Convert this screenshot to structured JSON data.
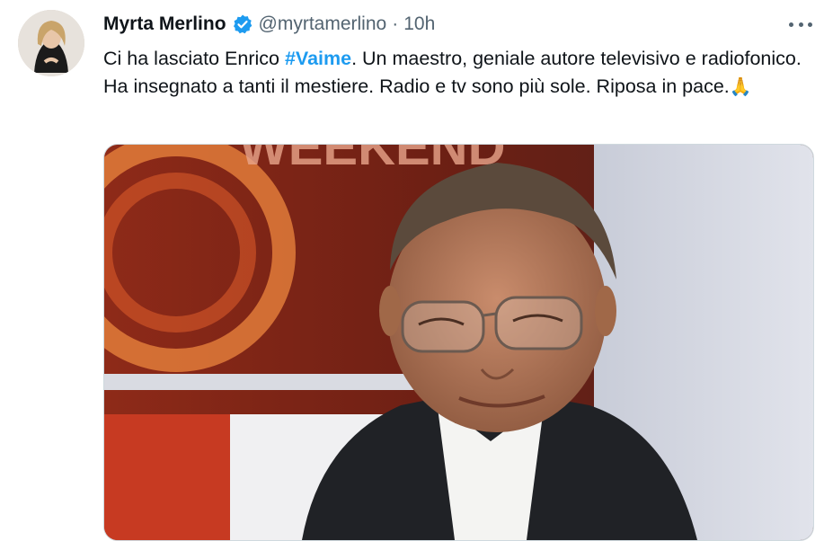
{
  "tweet": {
    "author_name": "Myrta Merlino",
    "handle": "@myrtamerlino",
    "separator": "·",
    "time": "10h",
    "text_before": "Ci ha lasciato Enrico ",
    "hashtag": "#Vaime",
    "text_after": ". Un maestro, geniale autore televisivo e radiofonico. Ha insegnato a tanti il mestiere. Radio e tv sono più sole. Riposa in pace.",
    "emoji": "🙏",
    "media_banner_text": "WEEKEND"
  },
  "icons": {
    "verified": "verified-badge-icon",
    "more": "more-options-icon"
  },
  "colors": {
    "accent": "#1d9bf0",
    "text": "#0f1419",
    "secondary": "#536471"
  }
}
